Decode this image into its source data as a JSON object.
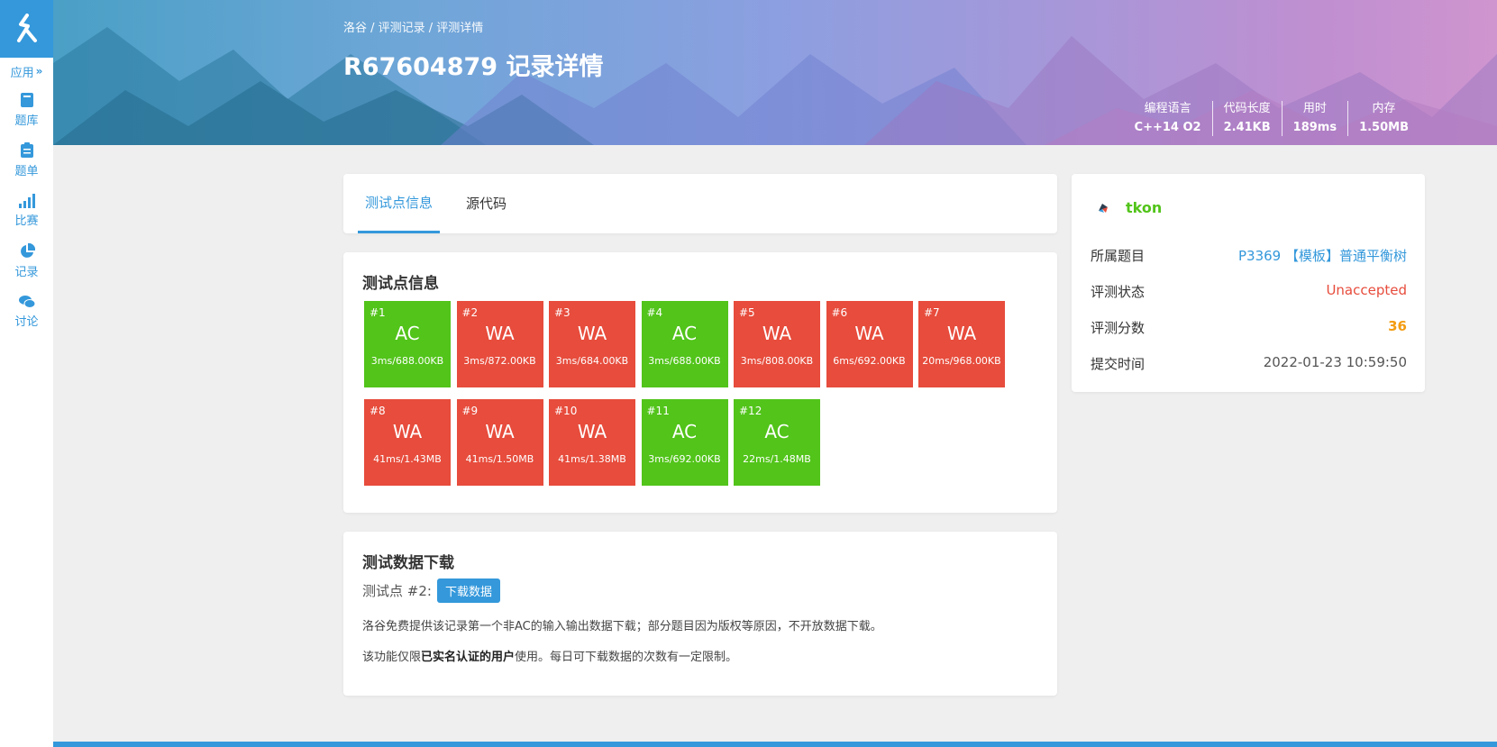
{
  "sidebar": {
    "apps_label": "应用",
    "items": [
      {
        "label": "题库",
        "icon": "book-icon"
      },
      {
        "label": "题单",
        "icon": "clipboard-icon"
      },
      {
        "label": "比赛",
        "icon": "bar-chart-icon"
      },
      {
        "label": "记录",
        "icon": "pie-chart-icon"
      },
      {
        "label": "讨论",
        "icon": "chat-icon"
      }
    ]
  },
  "header": {
    "breadcrumb": "洛谷 / 评测记录 / 评测详情",
    "title": "R67604879 记录详情",
    "stats": [
      {
        "label": "编程语言",
        "value": "C++14 O2"
      },
      {
        "label": "代码长度",
        "value": "2.41KB"
      },
      {
        "label": "用时",
        "value": "189ms"
      },
      {
        "label": "内存",
        "value": "1.50MB"
      }
    ]
  },
  "tabs": [
    {
      "label": "测试点信息",
      "active": true
    },
    {
      "label": "源代码",
      "active": false
    }
  ],
  "testcases": {
    "title": "测试点信息",
    "cases": [
      {
        "id": "#1",
        "status": "AC",
        "detail": "3ms/688.00KB"
      },
      {
        "id": "#2",
        "status": "WA",
        "detail": "3ms/872.00KB"
      },
      {
        "id": "#3",
        "status": "WA",
        "detail": "3ms/684.00KB"
      },
      {
        "id": "#4",
        "status": "AC",
        "detail": "3ms/688.00KB"
      },
      {
        "id": "#5",
        "status": "WA",
        "detail": "3ms/808.00KB"
      },
      {
        "id": "#6",
        "status": "WA",
        "detail": "6ms/692.00KB"
      },
      {
        "id": "#7",
        "status": "WA",
        "detail": "20ms/968.00KB"
      },
      {
        "id": "#8",
        "status": "WA",
        "detail": "41ms/1.43MB"
      },
      {
        "id": "#9",
        "status": "WA",
        "detail": "41ms/1.50MB"
      },
      {
        "id": "#10",
        "status": "WA",
        "detail": "41ms/1.38MB"
      },
      {
        "id": "#11",
        "status": "AC",
        "detail": "3ms/692.00KB"
      },
      {
        "id": "#12",
        "status": "AC",
        "detail": "22ms/1.48MB"
      }
    ]
  },
  "download": {
    "title": "测试数据下载",
    "label": "测试点 #2:",
    "button": "下载数据",
    "note1": "洛谷免费提供该记录第一个非AC的输入输出数据下载；部分题目因为版权等原因，不开放数据下载。",
    "note2_pre": "该功能仅限",
    "note2_bold": "已实名认证的用户",
    "note2_post": "使用。每日可下载数据的次数有一定限制。"
  },
  "info": {
    "username": "tkon",
    "rows": {
      "problem_label": "所属题目",
      "problem_value": "P3369 【模板】普通平衡树",
      "status_label": "评测状态",
      "status_value": "Unaccepted",
      "score_label": "评测分数",
      "score_value": "36",
      "time_label": "提交时间",
      "time_value": "2022-01-23 10:59:50"
    }
  },
  "colors": {
    "accent": "#3498db",
    "ac": "#52c41a",
    "wa": "#e74c3c",
    "score": "#f39c12"
  }
}
